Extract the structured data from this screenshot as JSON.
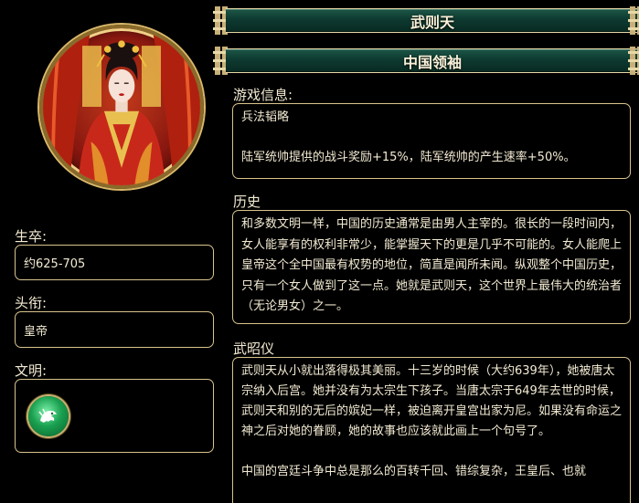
{
  "leader": {
    "name": "武则天",
    "subtitle": "中国领袖",
    "portrait_icon": "empress-portrait"
  },
  "left_panel": {
    "lifespan": {
      "label": "生卒:",
      "value": "约625-705"
    },
    "title": {
      "label": "头衔:",
      "value": "皇帝"
    },
    "civilization": {
      "label": "文明:",
      "icon": "dragon-emblem-icon"
    }
  },
  "game_info": {
    "label": "游戏信息:",
    "ability_name": "兵法韬略",
    "ability_desc": "陆军统帅提供的战斗奖励+15%，陆军统帅的产生速率+50%。"
  },
  "history": {
    "label": "历史",
    "text": "和多数文明一样，中国的历史通常是由男人主宰的。很长的一段时间内，女人能享有的权利非常少，能掌握天下的更是几乎不可能的。女人能爬上皇帝这个全中国最有权势的地位，简直是闻所未闻。纵观整个中国历史，只有一个女人做到了这一点。她就是武则天，这个世界上最伟大的统治者（无论男女）之一。"
  },
  "wu_zhaoyi": {
    "label": "武昭仪",
    "paragraph1": "武则天从小就出落得极其美丽。十三岁的时候（大约639年），她被唐太宗纳入后宫。她并没有为太宗生下孩子。当唐太宗于649年去世的时候，武则天和别的无后的嫔妃一样，被迫离开皇宫出家为尼。如果没有命运之神之后对她的眷顾，她的故事也应该就此画上一个句号了。",
    "paragraph2": "中国的宫廷斗争中总是那么的百转千回、错综复杂，王皇后、也就"
  },
  "colors": {
    "background": "#000000",
    "border_gold": "#d9c48c",
    "title_bar_green": "#0e3a30",
    "text": "#f2ead2"
  }
}
